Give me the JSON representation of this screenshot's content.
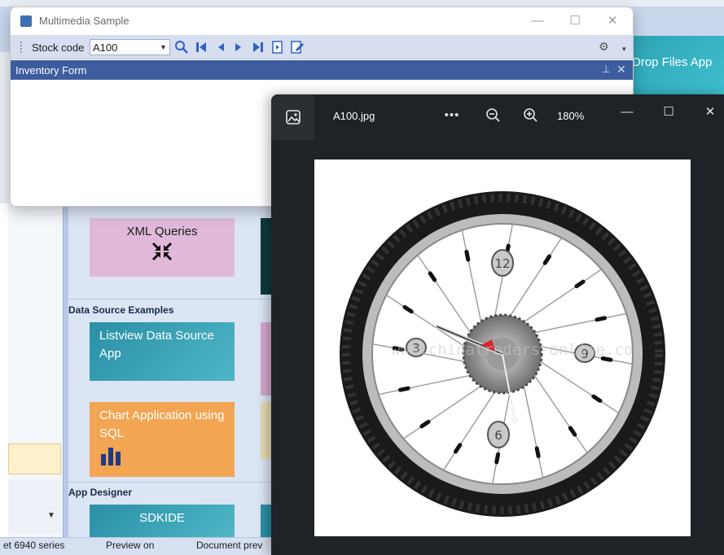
{
  "background_app": {
    "ribbon_tile_label": "Drop Files App",
    "group_headers": [
      "Data Source Examples",
      "App Designer"
    ],
    "tiles": {
      "xml_queries": "XML Queries",
      "listview": "Listview Data Source App",
      "chart_app": "Chart Application using SQL",
      "sdkide": "SDKIDE"
    },
    "status_bar": [
      "et 6940 series",
      "Preview on",
      "Document prev"
    ]
  },
  "multimedia_window": {
    "title": "Multimedia Sample",
    "toolbar": {
      "stock_code_label": "Stock code",
      "stock_code_value": "A100",
      "buttons": [
        "search-icon",
        "first-record-icon",
        "previous-record-icon",
        "next-record-icon",
        "last-record-icon",
        "new-record-icon",
        "edit-record-icon"
      ]
    },
    "panel_title": "Inventory Form",
    "caption_buttons": {
      "minimize": "—",
      "maximize": "☐",
      "close": "✕"
    }
  },
  "photo_viewer": {
    "filename": "A100.jpg",
    "zoom": "180%",
    "toolbar": {
      "more": "•••",
      "zoom_out_icon": "zoom-out-icon",
      "zoom_in_icon": "zoom-in-icon"
    },
    "image": {
      "subject": "bicycle wheel clock",
      "clock_numbers": [
        "12",
        "3",
        "6",
        "9"
      ],
      "watermark": "www.chinatraders-online.com"
    },
    "caption_buttons": {
      "minimize": "—",
      "maximize": "☐",
      "close": "✕"
    }
  },
  "colors": {
    "mm_panel_header": "#3e5d9e",
    "mm_toolbar": "#d6def0",
    "photo_bg": "#1f2226",
    "tile_teal": "#2a8fa5",
    "tile_orange": "#f2a552",
    "tile_pink": "#e0b9da"
  }
}
